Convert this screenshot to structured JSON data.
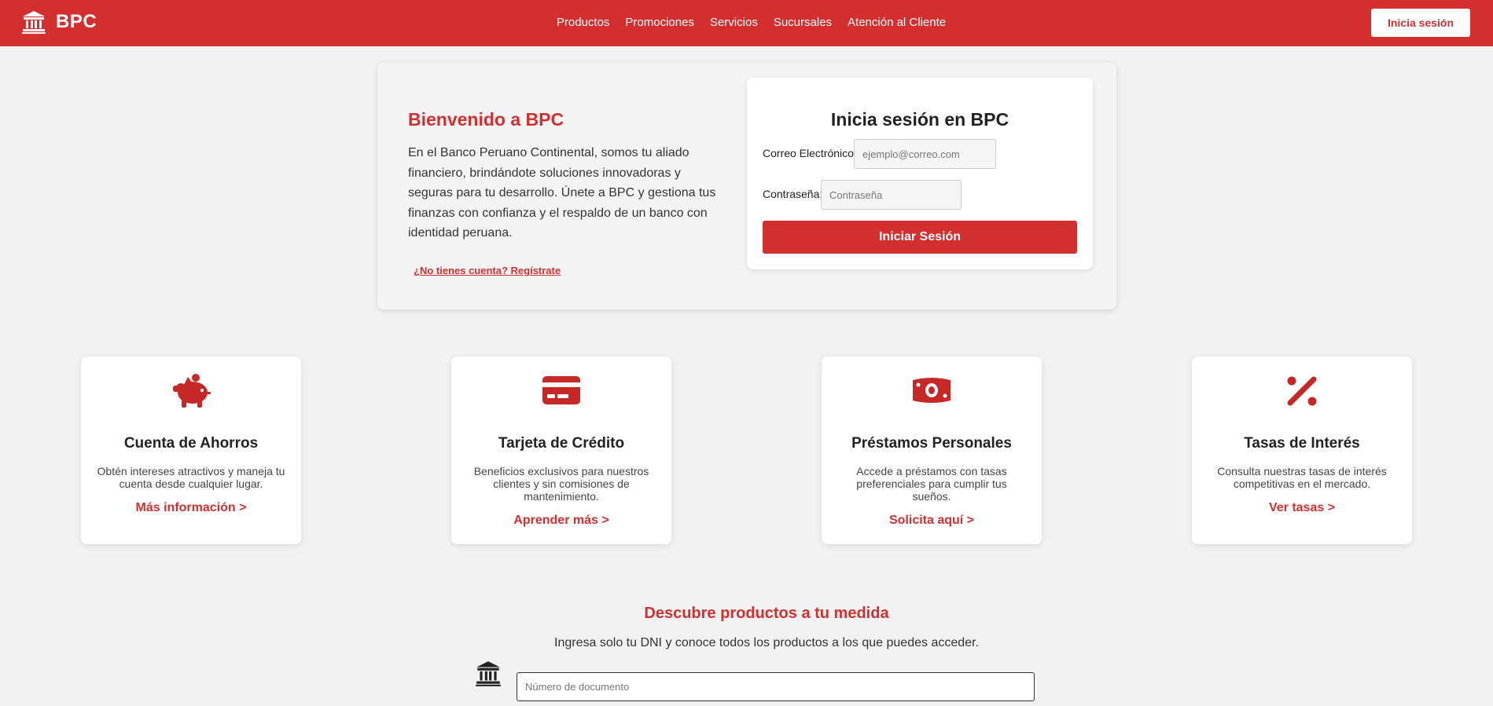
{
  "header": {
    "brand": "BPC",
    "nav": [
      "Productos",
      "Promociones",
      "Servicios",
      "Sucursales",
      "Atención al Cliente"
    ],
    "login_button": "Inicia sesión"
  },
  "hero": {
    "title": "Bienvenido a BPC",
    "text": "En el Banco Peruano Continental, somos tu aliado financiero, brindándote soluciones innovadoras y seguras para tu desarrollo. Únete a BPC y gestiona tus finanzas con confianza y el respaldo de un banco con identidad peruana.",
    "register_link": "¿No tienes cuenta? Regístrate"
  },
  "login": {
    "title": "Inicia sesión en BPC",
    "email_label": "Correo Electrónico:",
    "email_placeholder": "ejemplo@correo.com",
    "password_label": "Contraseña:",
    "password_placeholder": "Contraseña",
    "submit": "Iniciar Sesión"
  },
  "cards": [
    {
      "icon": "piggy-bank-icon",
      "title": "Cuenta de Ahorros",
      "desc": "Obtén intereses atractivos y maneja tu cuenta desde cualquier lugar.",
      "link": "Más información >"
    },
    {
      "icon": "credit-card-icon",
      "title": "Tarjeta de Crédito",
      "desc": "Beneficios exclusivos para nuestros clientes y sin comisiones de mantenimiento.",
      "link": "Aprender más >"
    },
    {
      "icon": "money-bill-icon",
      "title": "Préstamos Personales",
      "desc": "Accede a préstamos con tasas preferenciales para cumplir tus sueños.",
      "link": "Solicita aquí >"
    },
    {
      "icon": "percent-icon",
      "title": "Tasas de Interés",
      "desc": "Consulta nuestras tasas de interés competitivas en el mercado.",
      "link": "Ver tasas >"
    }
  ],
  "discover": {
    "title": "Descubre productos a tu medida",
    "subtitle": "Ingresa solo tu DNI y conoce todos los productos a los que puedes acceder.",
    "input_placeholder": "Número de documento"
  },
  "colors": {
    "primary": "#d32f2f",
    "icon_red": "#c62828",
    "background": "#f2f2f2"
  }
}
